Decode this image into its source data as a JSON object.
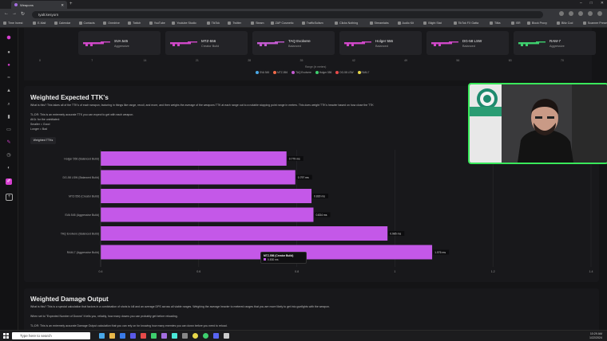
{
  "browser": {
    "tab_title": "Weapons",
    "url": "tyalt.kesyorn",
    "bookmarks": [
      "Time Invest",
      "E-Mail",
      "Calendar",
      "Contacts",
      "Onedrive",
      "Twitch",
      "YouTube",
      "Youtube Studio",
      "TikTok",
      "Twitter",
      "Steam",
      "ZAP Cosmetic",
      "TrafficSuitsm",
      "Clicks Nothing",
      "Streamlabs",
      "Audio Kit",
      "Blight Stat",
      "TikTok FX Gatta",
      "Tilita",
      "ISR",
      "Block Proxy",
      "Blitz Cod",
      "Scanner Preset"
    ]
  },
  "sidebar": {
    "icons": [
      "logo-icon",
      "dot-icon",
      "dot-icon",
      "wave-icon",
      "hat-icon",
      "search-icon",
      "chart-icon",
      "card-icon",
      "pen-icon",
      "clock-icon",
      "bookmark-icon",
      "edit-icon",
      "plus-icon"
    ]
  },
  "top_weapons": [
    {
      "name": "SVA 545",
      "type": "Aggressive",
      "color": "#d048c8"
    },
    {
      "name": "MTZ-556",
      "type": "Creator Build",
      "color": "#d048c8"
    },
    {
      "name": "TAQ Evolvere",
      "type": "Balanced",
      "color": "#c35ad0"
    },
    {
      "name": "Holger 556",
      "type": "Balanced",
      "color": "#d048c8"
    },
    {
      "name": "DG-58 LSW",
      "type": "Balanced",
      "color": "#d048c8"
    },
    {
      "name": "RAM-7",
      "type": "Aggressive",
      "color": "#3ecf6e"
    }
  ],
  "range_axis": {
    "ticks": [
      "0",
      "7",
      "14",
      "21",
      "28",
      "35",
      "42",
      "49",
      "56",
      "63",
      "70"
    ],
    "label": "Range (in meters)"
  },
  "range_legend": [
    {
      "label": "SVA 545",
      "color": "#4aa8e8"
    },
    {
      "label": "MTZ-556",
      "color": "#f06a4a"
    },
    {
      "label": "TAQ Evolvere",
      "color": "#c35ad0"
    },
    {
      "label": "Holger 556",
      "color": "#3ecf6e"
    },
    {
      "label": "DG-58 LSW",
      "color": "#e84a4a"
    },
    {
      "label": "RAM-7",
      "color": "#e8d84a"
    }
  ],
  "ttk_section": {
    "title": "Weighted Expected TTK's",
    "what_is_this": "What is this? This takes all of the TTK's of each weapon, factoring in things like range, recoil, and more, and then weighs the average of the weapons TTK at each range out to a notable stopping point range in meters. This does weight TTK's heavier based on how close the TTK",
    "tldr": "TL;DR: This is an extremely accurate TTK you can expect to get with each weapon.",
    "aka": "AKA: for the uninitiated:",
    "smaller": "Smaller = Good",
    "longer": "Longer = Bad",
    "tab_label": "Weighted TTKs"
  },
  "chart_data": {
    "type": "bar",
    "orientation": "horizontal",
    "categories": [
      "Holger 556 (Balanced Build)",
      "DG-58 LSW (Balanced Build)",
      "MTZ-556 (Creator Build)",
      "SVA 545 (Aggressive Build)",
      "TAQ Evolvere (Balanced Build)",
      "RAM-7 (Aggressive Build)"
    ],
    "values": [
      0.779,
      0.797,
      0.83,
      0.834,
      0.985,
      1.076
    ],
    "value_labels": [
      "0.779 ms",
      "0.797 ms",
      "0.830 ms",
      "0.834 ms",
      "0.985 ms",
      "1.076 ms"
    ],
    "bar_color": "#c458e8",
    "xlim": [
      0.4,
      1.4
    ],
    "x_ticks": [
      "0.4",
      "0.6",
      "0.8",
      "1",
      "1.2",
      "1.4"
    ],
    "x_tick_values": [
      0.4,
      0.6,
      0.8,
      1.0,
      1.2,
      1.4
    ],
    "grid": true
  },
  "tooltip": {
    "title": "MTZ-556 (Creator Build)",
    "value": "0.830 ms"
  },
  "damage_section": {
    "title": "Weighted Damage Output",
    "what_is_this": "What is this? This is a special calculation that factors in a combination of shots to kill and an average DPS across all viable ranges. Weighing the average heavier to metered ranges that you are more likely to get into gunfights with the weapon.",
    "expected_kills": "When set to \"Expected Number of Downs\" it tells you, reliably, how many downs you can probably get before reloading.",
    "tldr": "TL;DR: This is an extremely accurate Damage Output calculation that you can rely on for knowing how many enemies you can down before you need to reload."
  },
  "taskbar": {
    "search_placeholder": "Type here to search",
    "time": "10:29 AM",
    "date": "1/22/2024"
  }
}
